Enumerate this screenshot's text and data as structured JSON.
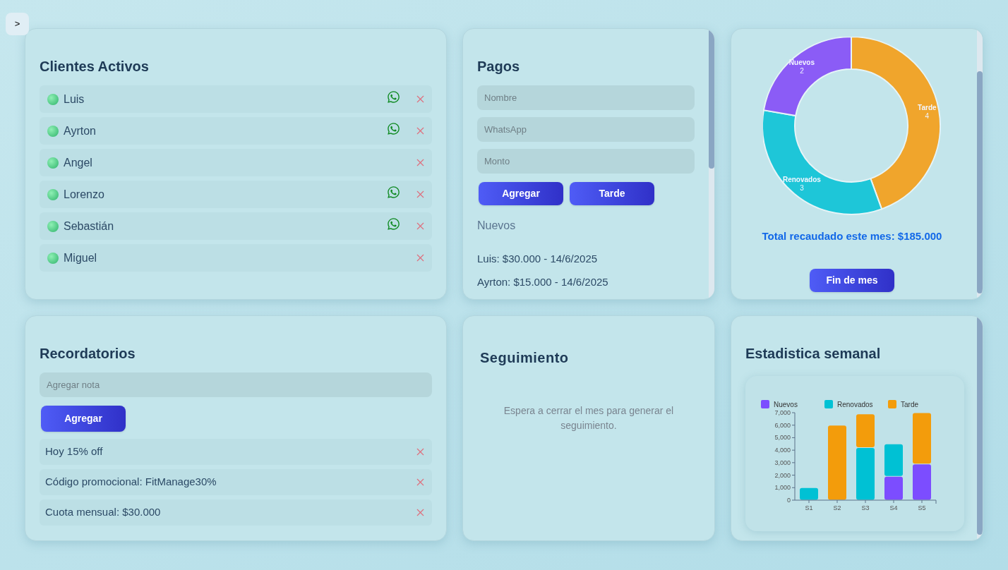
{
  "sidebar_toggle": ">",
  "clients": {
    "title": "Clientes Activos",
    "items": [
      {
        "name": "Luis",
        "whatsapp": true
      },
      {
        "name": "Ayrton",
        "whatsapp": true
      },
      {
        "name": "Angel",
        "whatsapp": false
      },
      {
        "name": "Lorenzo",
        "whatsapp": true
      },
      {
        "name": "Sebastián",
        "whatsapp": true
      },
      {
        "name": "Miguel",
        "whatsapp": false
      }
    ]
  },
  "payments": {
    "title": "Pagos",
    "fields": [
      {
        "placeholder": "Nombre"
      },
      {
        "placeholder": "WhatsApp"
      },
      {
        "placeholder": "Monto"
      }
    ],
    "buttons": [
      "Agregar",
      "Tarde"
    ],
    "section": "Nuevos",
    "entries": [
      "Luis: $30.000 - 14/6/2025",
      "Ayrton: $15.000 - 14/6/2025"
    ]
  },
  "summary": {
    "chart_data": {
      "type": "donut",
      "categories": [
        "Tarde",
        "Renovados",
        "Nuevos"
      ],
      "values": [
        4,
        3,
        2
      ],
      "colors": [
        "#f0a52c",
        "#1ec6d8",
        "#8b5cf6"
      ],
      "data_labels": true
    },
    "total": "Total recaudado este mes: $185.000",
    "button": "Fin de mes"
  },
  "reminders": {
    "title": "Recordatorios",
    "placeholder": "Agregar nota",
    "button": "Agregar",
    "items": [
      "Hoy 15% off",
      "Código promocional: FitManage30%",
      "Cuota mensual: $30.000"
    ]
  },
  "followup": {
    "title": "Seguimiento",
    "message": "Espera a cerrar el mes para generar el seguimiento."
  },
  "weekly": {
    "title": "Estadistica semanal",
    "chart_data": {
      "type": "bar",
      "stacked": true,
      "categories": [
        "S1",
        "S2",
        "S3",
        "S4",
        "S5"
      ],
      "series": [
        {
          "name": "Nuevos",
          "color": "#7c4dff",
          "values": [
            0,
            0,
            0,
            1.9,
            2.9
          ]
        },
        {
          "name": "Renovados",
          "color": "#00c1d4",
          "values": [
            1,
            0,
            4.2,
            2.6,
            0
          ]
        },
        {
          "name": "Tarde",
          "color": "#f39c0b",
          "values": [
            0,
            6,
            2.7,
            0,
            4.1
          ]
        }
      ],
      "legend": "top",
      "ylim": [
        0,
        7
      ],
      "yticks": [
        {
          "value": 0,
          "label": "0"
        },
        {
          "value": 1,
          "label": "1,000"
        },
        {
          "value": 2,
          "label": "2,000"
        },
        {
          "value": 3,
          "label": "3,000"
        },
        {
          "value": 4,
          "label": "4,000"
        },
        {
          "value": 5,
          "label": "5,000"
        },
        {
          "value": 6,
          "label": "6,000"
        },
        {
          "value": 7,
          "label": "7,000"
        }
      ]
    }
  }
}
